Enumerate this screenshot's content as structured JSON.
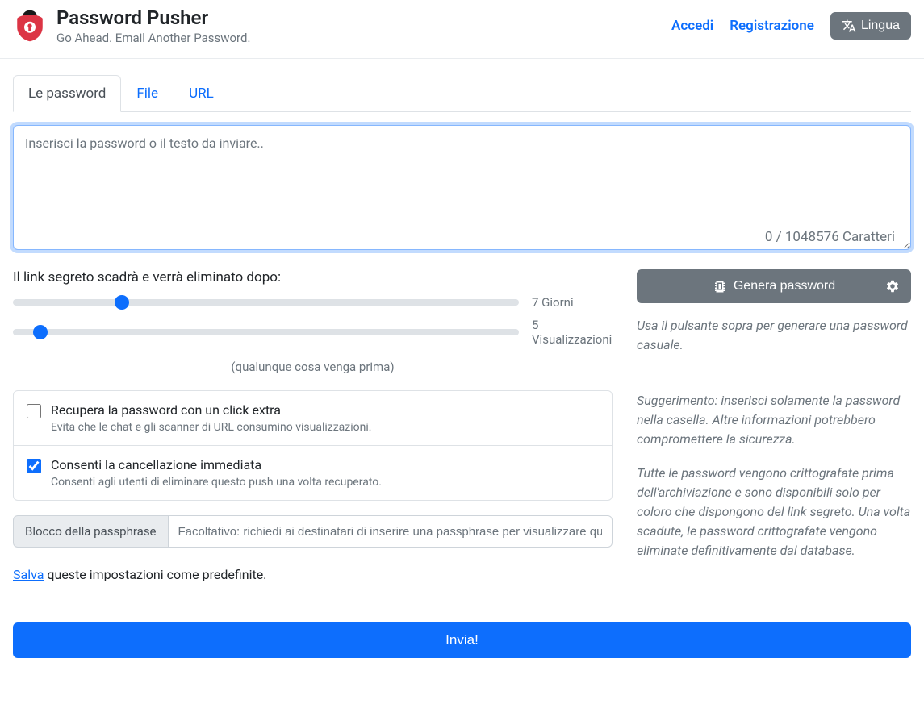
{
  "header": {
    "title": "Password Pusher",
    "subtitle": "Go Ahead. Email Another Password.",
    "login": "Accedi",
    "register": "Registrazione",
    "language": "Lingua"
  },
  "tabs": {
    "passwords": "Le password",
    "file": "File",
    "url": "URL"
  },
  "textarea": {
    "placeholder": "Inserisci la password o il testo da inviare..",
    "char_count": "0 / 1048576 Caratteri"
  },
  "expire": {
    "label": "Il link segreto scadrà e verrà eliminato dopo:",
    "days_value": "7",
    "days_unit": "Giorni",
    "views_value": "5",
    "views_unit": "Visualizzazioni",
    "whichever": "(qualunque cosa venga prima)"
  },
  "options": {
    "retrieve_title": "Recupera la password con un click extra",
    "retrieve_desc": "Evita che le chat e gli scanner di URL consumino visualizzazioni.",
    "delete_title": "Consenti la cancellazione immediata",
    "delete_desc": "Consenti agli utenti di eliminare questo push una volta recuperato."
  },
  "passphrase": {
    "label": "Blocco della passphrase",
    "placeholder": "Facoltativo: richiedi ai destinatari di inserire una passphrase per visualizzare questo push"
  },
  "save": {
    "link": "Salva",
    "text": " queste impostazioni come predefinite."
  },
  "sidebar": {
    "generate": "Genera password",
    "use_button_text": "Usa il pulsante sopra per generare una password casuale.",
    "tip": "Suggerimento: inserisci solamente la password nella casella. Altre informazioni potrebbero compromettere la sicurezza.",
    "encrypt": "Tutte le password vengono crittografate prima dell'archiviazione e sono disponibili solo per coloro che dispongono del link segreto. Una volta scadute, le password crittografate vengono eliminate definitivamente dal database."
  },
  "submit": "Invia!"
}
